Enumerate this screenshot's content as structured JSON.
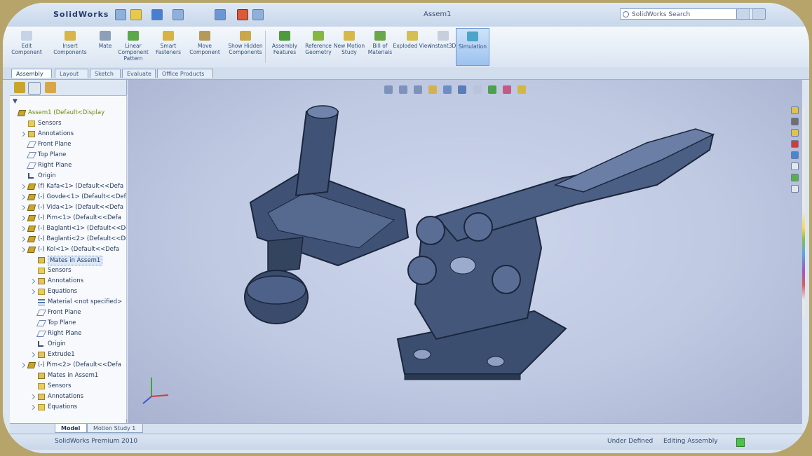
{
  "titlebar": {
    "logo": "SolidWorks",
    "doc_title": "Assem1",
    "search_placeholder": "SolidWorks Search"
  },
  "ribbon": {
    "buttons": [
      {
        "label": "Edit Component",
        "icon": "edit-component-icon"
      },
      {
        "label": "Insert Components",
        "icon": "insert-components-icon"
      },
      {
        "label": "Mate",
        "icon": "mate-icon"
      },
      {
        "label": "Linear Component Pattern",
        "icon": "linear-pattern-icon"
      },
      {
        "label": "Smart Fasteners",
        "icon": "smart-fasteners-icon"
      },
      {
        "label": "Move Component",
        "icon": "move-component-icon"
      },
      {
        "label": "Show Hidden Components",
        "icon": "show-hidden-icon"
      },
      {
        "label": "Assembly Features",
        "icon": "assembly-features-icon"
      },
      {
        "label": "Reference Geometry",
        "icon": "reference-geometry-icon"
      },
      {
        "label": "New Motion Study",
        "icon": "new-motion-study-icon"
      },
      {
        "label": "Bill of Materials",
        "icon": "bill-of-materials-icon"
      },
      {
        "label": "Exploded View",
        "icon": "exploded-view-icon"
      },
      {
        "label": "Instant3D",
        "icon": "instant3d-icon"
      },
      {
        "label": "Simulation",
        "icon": "simulation-icon"
      }
    ]
  },
  "tabs": [
    {
      "label": "Assembly",
      "active": true
    },
    {
      "label": "Layout",
      "active": false
    },
    {
      "label": "Sketch",
      "active": false
    },
    {
      "label": "Evaluate",
      "active": false
    },
    {
      "label": "Office Products",
      "active": false
    }
  ],
  "tree": {
    "filter_label": "▼",
    "rows": [
      {
        "text": "Assem1 (Default<Display",
        "icon": "asm",
        "indent": 0,
        "root": true
      },
      {
        "text": "Sensors",
        "icon": "folder",
        "indent": 1
      },
      {
        "text": "Annotations",
        "icon": "annot",
        "indent": 1,
        "expand": true
      },
      {
        "text": "Front Plane",
        "icon": "plane",
        "indent": 1
      },
      {
        "text": "Top Plane",
        "icon": "plane",
        "indent": 1
      },
      {
        "text": "Right Plane",
        "icon": "plane",
        "indent": 1
      },
      {
        "text": "Origin",
        "icon": "origin",
        "indent": 1
      },
      {
        "text": "(f) Kafa<1> (Default<<Defa",
        "icon": "asm",
        "indent": 1,
        "expand": true
      },
      {
        "text": "(-) Govde<1> (Default<<Defa",
        "icon": "asm",
        "indent": 1,
        "expand": true
      },
      {
        "text": "(-) Vida<1> (Default<<Defa",
        "icon": "asm",
        "indent": 1,
        "expand": true
      },
      {
        "text": "(-) Pim<1> (Default<<Defa",
        "icon": "asm",
        "indent": 1,
        "expand": true
      },
      {
        "text": "(-) Baglanti<1> (Default<<Defa",
        "icon": "asm",
        "indent": 1,
        "expand": true
      },
      {
        "text": "(-) Baglanti<2> (Default<<Defa",
        "icon": "asm",
        "indent": 1,
        "expand": true
      },
      {
        "text": "(-) Kol<1> (Default<<Defa",
        "icon": "asm",
        "indent": 1,
        "expand": true
      },
      {
        "text": "Mates in Assem1",
        "icon": "mates",
        "indent": 2,
        "hi": true
      },
      {
        "text": "Sensors",
        "icon": "folder",
        "indent": 2
      },
      {
        "text": "Annotations",
        "icon": "annot",
        "indent": 2,
        "expand": true
      },
      {
        "text": "Equations",
        "icon": "folder",
        "indent": 2,
        "expand": true
      },
      {
        "text": "Material <not specified>",
        "icon": "material",
        "indent": 2
      },
      {
        "text": "Front Plane",
        "icon": "plane",
        "indent": 2
      },
      {
        "text": "Top Plane",
        "icon": "plane",
        "indent": 2
      },
      {
        "text": "Right Plane",
        "icon": "plane",
        "indent": 2
      },
      {
        "text": "Origin",
        "icon": "origin",
        "indent": 2
      },
      {
        "text": "Extrude1",
        "icon": "annot",
        "indent": 2,
        "expand": true
      },
      {
        "text": "(-) Pim<2> (Default<<Defa",
        "icon": "asm",
        "indent": 1,
        "expand": true
      },
      {
        "text": "Mates in Assem1",
        "icon": "mates",
        "indent": 2
      },
      {
        "text": "Sensors",
        "icon": "folder",
        "indent": 2
      },
      {
        "text": "Annotations",
        "icon": "annot",
        "indent": 2,
        "expand": true
      },
      {
        "text": "Equations",
        "icon": "folder",
        "indent": 2,
        "expand": true
      }
    ]
  },
  "bottom_tabs": [
    {
      "label": "Model",
      "active": true
    },
    {
      "label": "Motion Study 1",
      "active": false
    }
  ],
  "status": {
    "left": "SolidWorks Premium 2010",
    "units": "Under Defined",
    "mode": "Editing Assembly"
  },
  "colors": {
    "model": "#3e5274",
    "model_edge": "#1d2a40",
    "viewport_bg": "#c3cce4"
  }
}
